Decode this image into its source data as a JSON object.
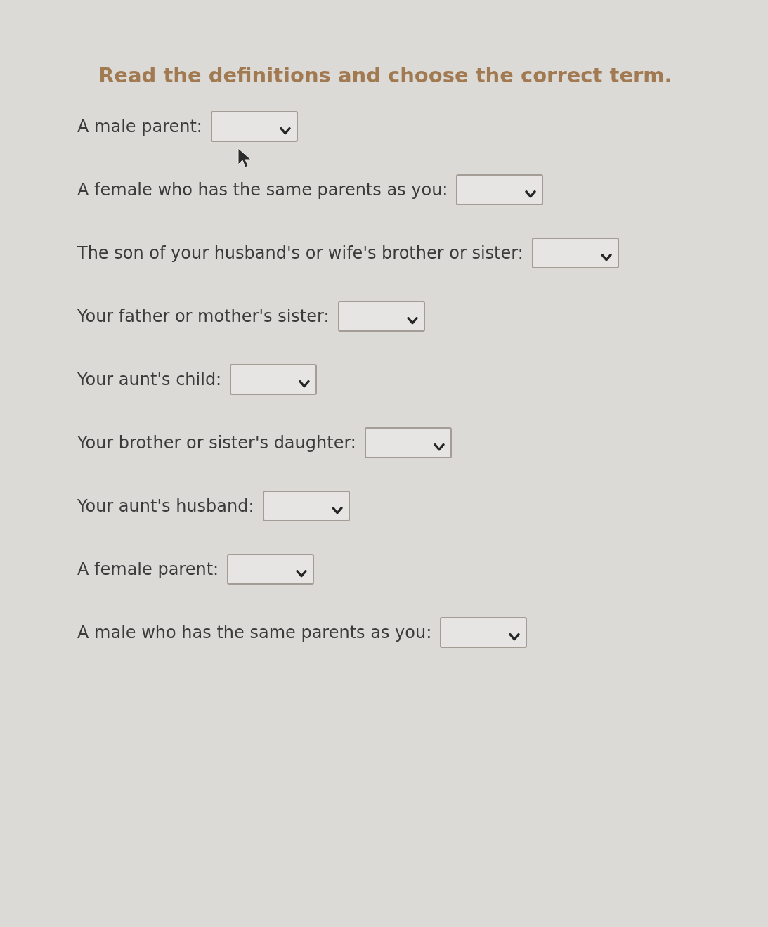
{
  "instruction": "Read the definitions and choose the correct term.",
  "questions": [
    {
      "label": "A male parent:"
    },
    {
      "label": "A female who has the same parents as you:"
    },
    {
      "label": "The son of your husband's or wife's brother or sister:"
    },
    {
      "label": "Your father or mother's sister:"
    },
    {
      "label": "Your aunt's child:"
    },
    {
      "label": "Your brother or sister's daughter:"
    },
    {
      "label": "Your aunt's husband:"
    },
    {
      "label": "A female parent:"
    },
    {
      "label": "A male who has the same parents as you:"
    }
  ]
}
